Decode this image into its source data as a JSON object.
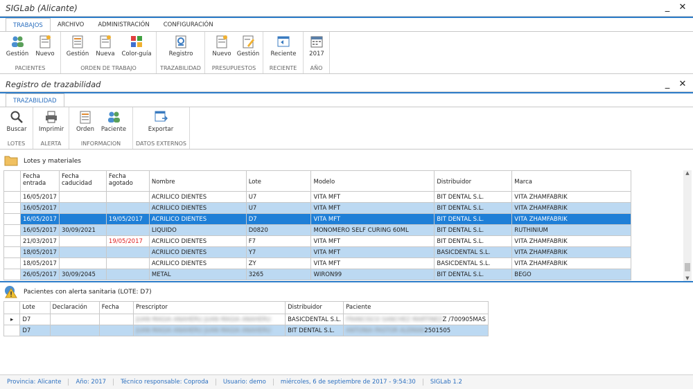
{
  "window": {
    "title": "SIGLab (Alicante)"
  },
  "main_tabs": [
    "TRABAJOS",
    "ARCHIVO",
    "ADMINISTRACIÓN",
    "CONFIGURACIÓN"
  ],
  "main_groups": {
    "pacientes": {
      "label": "PACIENTES",
      "buttons": [
        "Gestión",
        "Nuevo"
      ]
    },
    "orden": {
      "label": "ORDEN DE TRABAJO",
      "buttons": [
        "Gestión",
        "Nueva",
        "Color-guía"
      ]
    },
    "trazabilidad": {
      "label": "TRAZABILIDAD",
      "buttons": [
        "Registro"
      ]
    },
    "presupuestos": {
      "label": "PRESUPUESTOS",
      "buttons": [
        "Nuevo",
        "Gestión"
      ]
    },
    "reciente": {
      "label": "RECIENTE",
      "buttons": [
        "Reciente"
      ]
    },
    "anio": {
      "label": "AÑO",
      "buttons": [
        "2017"
      ]
    }
  },
  "sub_window": {
    "title": "Registro de trazabilidad"
  },
  "sub_tab": "TRAZABILIDAD",
  "sub_groups": {
    "lotes": {
      "label": "LOTES",
      "buttons": [
        "Buscar"
      ]
    },
    "alerta": {
      "label": "ALERTA",
      "buttons": [
        "Imprimir"
      ]
    },
    "informacion": {
      "label": "INFORMACION",
      "buttons": [
        "Orden",
        "Paciente"
      ]
    },
    "externos": {
      "label": "DATOS EXTERNOS",
      "buttons": [
        "Exportar"
      ]
    }
  },
  "lotes_section": {
    "title": "Lotes y materiales",
    "columns": [
      "Fecha entrada",
      "Fecha caducidad",
      "Fecha agotado",
      "Nombre",
      "Lote",
      "Modelo",
      "Distribuidor",
      "Marca"
    ],
    "rows": [
      [
        "16/05/2017",
        "",
        "",
        "ACRILICO DIENTES",
        "U7",
        "VITA MFT",
        "BIT DENTAL S.L.",
        "VITA ZHAMFABRIK"
      ],
      [
        "16/05/2017",
        "",
        "",
        "ACRILICO DIENTES",
        "U7",
        "VITA MFT",
        "BIT DENTAL S.L.",
        "VITA ZHAMFABRIK"
      ],
      [
        "16/05/2017",
        "",
        "19/05/2017",
        "ACRILICO DIENTES",
        "D7",
        "VITA MFT",
        "BIT DENTAL S.L.",
        "VITA ZHAMFABRIK"
      ],
      [
        "16/05/2017",
        "30/09/2021",
        "",
        "LIQUIDO",
        "D0820",
        "MONOMERO SELF CURING 60ML",
        "BIT DENTAL S.L.",
        "RUTHINIUM"
      ],
      [
        "21/03/2017",
        "",
        "19/05/2017",
        "ACRILICO DIENTES",
        "F7",
        "VITA MFT",
        "BIT DENTAL S.L.",
        "VITA ZHAMFABRIK"
      ],
      [
        "18/05/2017",
        "",
        "",
        "ACRILICO DIENTES",
        "Y7",
        "VITA MFT",
        "BASICDENTAL S.L.",
        "VITA ZHAMFABRIK"
      ],
      [
        "18/05/2017",
        "",
        "",
        "ACRILICO DIENTES",
        "ZY",
        "VITA MFT",
        "BASICDENTAL S.L.",
        "VITA ZHAMFABRIK"
      ],
      [
        "26/05/2017",
        "30/09/2045",
        "",
        "METAL",
        "3265",
        "WIRON99",
        "BIT DENTAL S.L.",
        "BEGO"
      ]
    ]
  },
  "alerta_section": {
    "title": "Pacientes con alerta sanitaria (LOTE: D7)",
    "columns": [
      "Lote",
      "Declaración",
      "Fecha",
      "Prescriptor",
      "Distribuidor",
      "Paciente"
    ],
    "rows": [
      [
        "D7",
        "",
        "",
        "JUAN MAGIA ANAHERU JUAN MAGIA ANAHERU",
        "BASICDENTAL S.L.",
        "FRANCISCO SANCHEZ MARTINEZ",
        "Z /700905MAS"
      ],
      [
        "D7",
        "",
        "",
        "JUAN MAGIA ANAHERU JUAN MAGIA ANAHERU",
        "BIT DENTAL S.L.",
        "ANTONIA PASTOR ALEMAN",
        "2501505"
      ]
    ]
  },
  "statusbar": [
    "Provincia: Alicante",
    "Año: 2017",
    "Técnico responsable: Coproda",
    "Usuario: demo",
    "miércoles, 6 de septiembre de 2017 - 9:54:30",
    "SIGLab 1.2"
  ],
  "colors": {
    "accent": "#2b7bc8",
    "row_alt": "#bcd9f2",
    "row_selected": "#1f7fd7",
    "alert_red": "#e02020"
  }
}
